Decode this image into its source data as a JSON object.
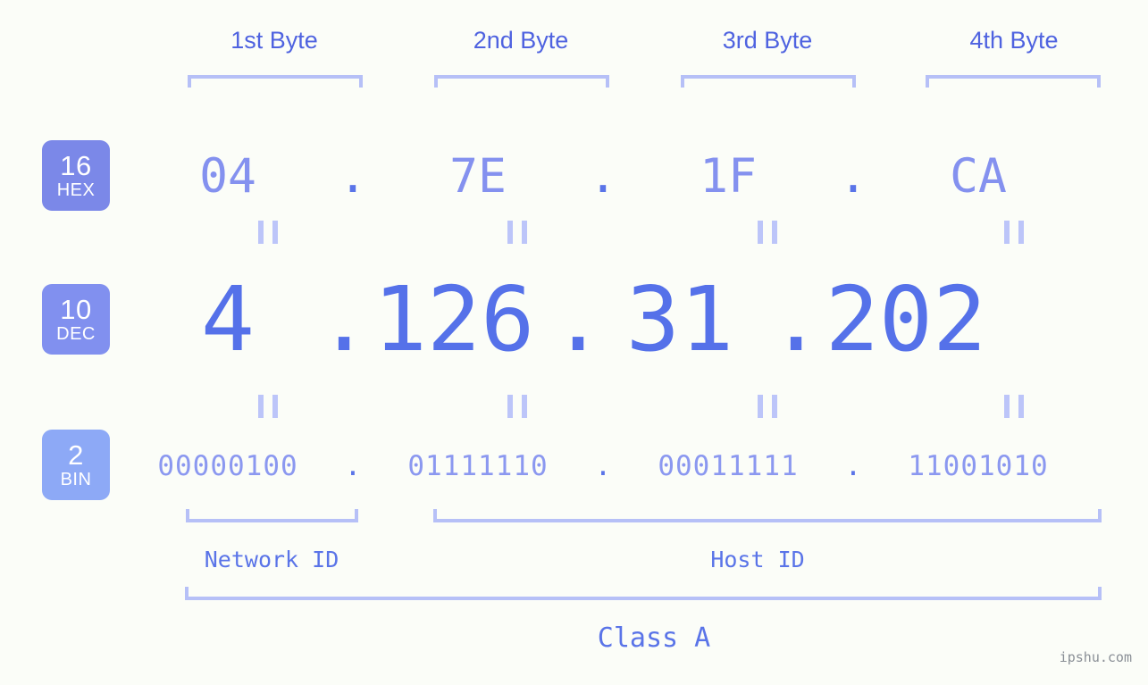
{
  "diagram": {
    "background_color": "#fbfdf8",
    "accent_color": "#5571e9",
    "accent_light": "#8b98f0",
    "bracket_color": "#b6c0f7",
    "byte_headers": [
      {
        "label": "1st Byte"
      },
      {
        "label": "2nd Byte"
      },
      {
        "label": "3rd Byte"
      },
      {
        "label": "4th Byte"
      }
    ],
    "radix_badges": [
      {
        "number": "16",
        "name": "HEX",
        "color": "#7b88e8"
      },
      {
        "number": "10",
        "name": "DEC",
        "color": "#8190ef"
      },
      {
        "number": "2",
        "name": "BIN",
        "color": "#8da9f6"
      }
    ],
    "separator": ".",
    "rows": {
      "hex": {
        "values": [
          "04",
          "7E",
          "1F",
          "CA"
        ]
      },
      "dec": {
        "values": [
          "4",
          "126",
          "31",
          "202"
        ]
      },
      "bin": {
        "values": [
          "00000100",
          "01111110",
          "00011111",
          "11001010"
        ]
      }
    },
    "equals_symbol": "=",
    "segments": [
      {
        "label": "Network ID"
      },
      {
        "label": "Host ID"
      }
    ],
    "class_label": "Class A",
    "watermark": "ipshu.com"
  }
}
